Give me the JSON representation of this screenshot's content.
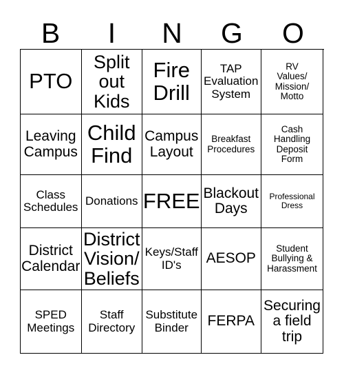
{
  "card": {
    "header_letters": [
      "B",
      "I",
      "N",
      "G",
      "O"
    ],
    "columns": 5,
    "rows": 5,
    "free_space_label": "FREE",
    "free_space_position": {
      "row": 3,
      "column": 3
    },
    "grid": [
      [
        {
          "text": "PTO",
          "size": "xl"
        },
        {
          "text": "Split\nout\nKids",
          "size": "lg"
        },
        {
          "text": "Fire\nDrill",
          "size": "xl"
        },
        {
          "text": "TAP\nEvaluation\nSystem",
          "size": "sm"
        },
        {
          "text": "RV\nValues/\nMission/\nMotto",
          "size": "xs"
        }
      ],
      [
        {
          "text": "Leaving\nCampus",
          "size": "md"
        },
        {
          "text": "Child\nFind",
          "size": "xl"
        },
        {
          "text": "Campus\nLayout",
          "size": "md"
        },
        {
          "text": "Breakfast\nProcedures",
          "size": "xs"
        },
        {
          "text": "Cash\nHandling\nDeposit\nForm",
          "size": "xs"
        }
      ],
      [
        {
          "text": "Class\nSchedules",
          "size": "sm"
        },
        {
          "text": "Donations",
          "size": "sm"
        },
        {
          "text": "FREE",
          "size": "xl"
        },
        {
          "text": "Blackout\nDays",
          "size": "md"
        },
        {
          "text": "Professional\nDress",
          "size": "xxs"
        }
      ],
      [
        {
          "text": "District\nCalendar",
          "size": "md"
        },
        {
          "text": "District\nVision/\nBeliefs",
          "size": "lg"
        },
        {
          "text": "Keys/Staff\nID's",
          "size": "sm"
        },
        {
          "text": "AESOP",
          "size": "md"
        },
        {
          "text": "Student\nBullying &\nHarassment",
          "size": "xs"
        }
      ],
      [
        {
          "text": "SPED\nMeetings",
          "size": "sm"
        },
        {
          "text": "Staff\nDirectory",
          "size": "sm"
        },
        {
          "text": "Substitute\nBinder",
          "size": "sm"
        },
        {
          "text": "FERPA",
          "size": "md"
        },
        {
          "text": "Securing\na field\ntrip",
          "size": "md"
        }
      ]
    ]
  },
  "colors": {
    "background": "#ffffff",
    "text": "#000000",
    "grid_line": "#000000"
  }
}
